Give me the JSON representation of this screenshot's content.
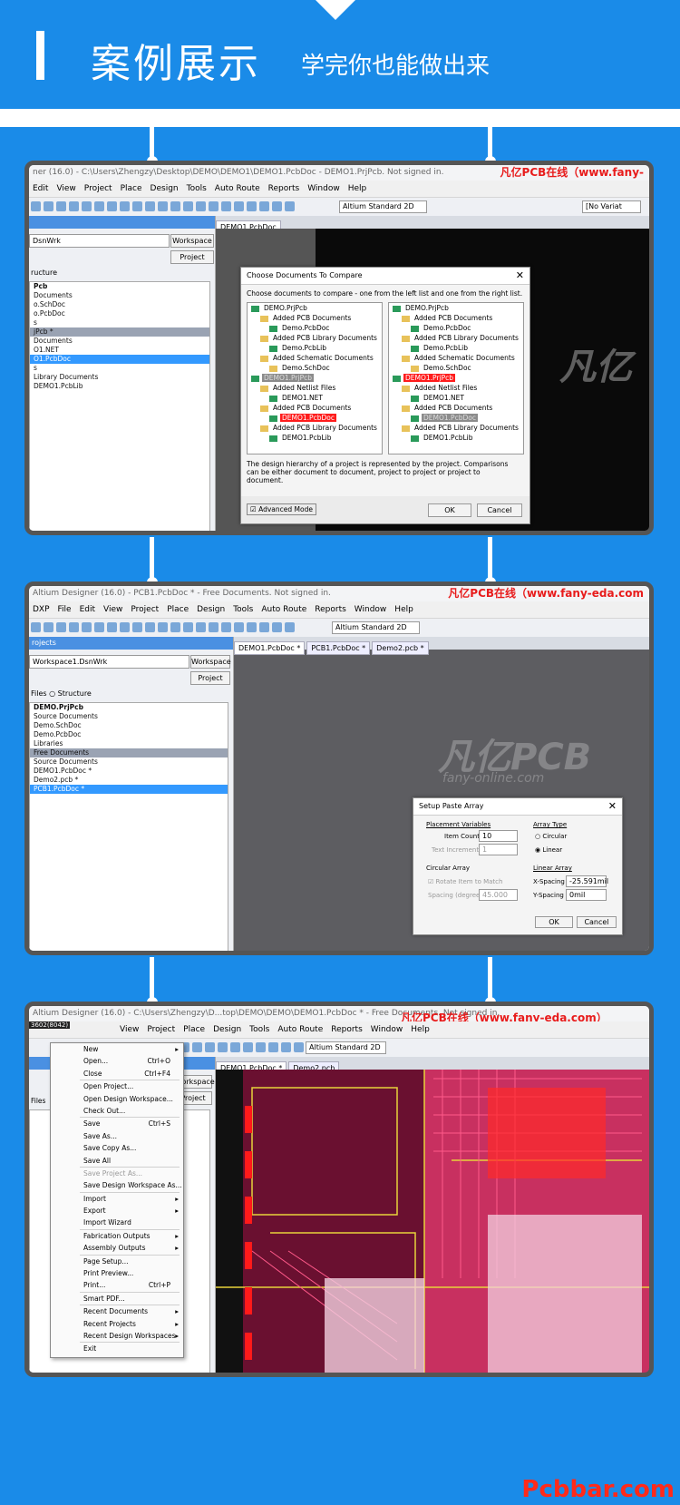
{
  "header": {
    "title": "案例展示",
    "subtitle": "学完你也能做出来"
  },
  "brand": "凡亿PCB在线（www.fany-eda.com）",
  "footer": "Pcbbar.com",
  "panel1": {
    "title": "ner (16.0) - C:\\Users\\Zhengzy\\Desktop\\DEMO\\DEMO1\\DEMO1.PcbDoc - DEMO1.PrjPcb. Not signed in.",
    "brand": "凡亿PCB在线（www.fany-",
    "menu": [
      "Edit",
      "View",
      "Project",
      "Place",
      "Design",
      "Tools",
      "Auto Route",
      "Reports",
      "Window",
      "Help"
    ],
    "view_mode": "Altium Standard 2D",
    "variant": "[No Variat",
    "workspace_value": "DsnWrk",
    "workspace_btn": "Workspace",
    "project_btn": "Project",
    "structure_label": "ructure",
    "tree": [
      {
        "text": "Pcb",
        "cls": "bold"
      },
      {
        "text": "Documents",
        "cls": ""
      },
      {
        "text": "o.SchDoc",
        "cls": ""
      },
      {
        "text": "o.PcbDoc",
        "cls": ""
      },
      {
        "text": "s",
        "cls": ""
      },
      {
        "text": "jPcb *",
        "cls": "grey"
      },
      {
        "text": "Documents",
        "cls": ""
      },
      {
        "text": "O1.NET",
        "cls": ""
      },
      {
        "text": "O1.PcbDoc",
        "cls": "sel"
      },
      {
        "text": "s",
        "cls": ""
      },
      {
        "text": "Library Documents",
        "cls": ""
      },
      {
        "text": "DEMO1.PcbLib",
        "cls": ""
      }
    ],
    "doc_tab": "DEMO1.PcbDoc",
    "dialog": {
      "title": "Choose Documents To Compare",
      "instruction": "Choose documents to compare - one from the left list and one from the right list.",
      "left_tree": [
        {
          "text": "DEMO.PrjPcb",
          "indent": 0,
          "cls": "",
          "icon": "pcb"
        },
        {
          "text": "Added PCB Documents",
          "indent": 1,
          "cls": "",
          "icon": "folder"
        },
        {
          "text": "Demo.PcbDoc",
          "indent": 2,
          "cls": "",
          "icon": "pcb"
        },
        {
          "text": "Added PCB Library Documents",
          "indent": 1,
          "cls": "",
          "icon": "folder"
        },
        {
          "text": "Demo.PcbLib",
          "indent": 2,
          "cls": "",
          "icon": "pcb"
        },
        {
          "text": "Added Schematic Documents",
          "indent": 1,
          "cls": "",
          "icon": "folder"
        },
        {
          "text": "Demo.SchDoc",
          "indent": 2,
          "cls": "",
          "icon": "folder"
        },
        {
          "text": "DEMO1.PrjPcb",
          "indent": 0,
          "cls": "graysel",
          "icon": "pcb"
        },
        {
          "text": "Added Netlist Files",
          "indent": 1,
          "cls": "",
          "icon": "folder"
        },
        {
          "text": "DEMO1.NET",
          "indent": 2,
          "cls": "",
          "icon": "pcb"
        },
        {
          "text": "Added PCB Documents",
          "indent": 1,
          "cls": "",
          "icon": "folder"
        },
        {
          "text": "DEMO1.PcbDoc",
          "indent": 2,
          "cls": "redsel",
          "icon": "pcb"
        },
        {
          "text": "Added PCB Library Documents",
          "indent": 1,
          "cls": "",
          "icon": "folder"
        },
        {
          "text": "DEMO1.PcbLib",
          "indent": 2,
          "cls": "",
          "icon": "pcb"
        }
      ],
      "right_tree": [
        {
          "text": "DEMO.PrjPcb",
          "indent": 0,
          "cls": "",
          "icon": "pcb"
        },
        {
          "text": "Added PCB Documents",
          "indent": 1,
          "cls": "",
          "icon": "folder"
        },
        {
          "text": "Demo.PcbDoc",
          "indent": 2,
          "cls": "",
          "icon": "pcb"
        },
        {
          "text": "Added PCB Library Documents",
          "indent": 1,
          "cls": "",
          "icon": "folder"
        },
        {
          "text": "Demo.PcbLib",
          "indent": 2,
          "cls": "",
          "icon": "pcb"
        },
        {
          "text": "Added Schematic Documents",
          "indent": 1,
          "cls": "",
          "icon": "folder"
        },
        {
          "text": "Demo.SchDoc",
          "indent": 2,
          "cls": "",
          "icon": "folder"
        },
        {
          "text": "DEMO1.PrjPcb",
          "indent": 0,
          "cls": "redsel",
          "icon": "pcb"
        },
        {
          "text": "Added Netlist Files",
          "indent": 1,
          "cls": "",
          "icon": "folder"
        },
        {
          "text": "DEMO1.NET",
          "indent": 2,
          "cls": "",
          "icon": "pcb"
        },
        {
          "text": "Added PCB Documents",
          "indent": 1,
          "cls": "",
          "icon": "folder"
        },
        {
          "text": "DEMO1.PcbDoc",
          "indent": 2,
          "cls": "graysel",
          "icon": "pcb"
        },
        {
          "text": "Added PCB Library Documents",
          "indent": 1,
          "cls": "",
          "icon": "folder"
        },
        {
          "text": "DEMO1.PcbLib",
          "indent": 2,
          "cls": "",
          "icon": "pcb"
        }
      ],
      "note": "The design hierarchy of a project is represented by the project. Comparisons can be either document to document, project to project or project to document.",
      "advanced": "Advanced Mode",
      "ok": "OK",
      "cancel": "Cancel"
    }
  },
  "panel2": {
    "title": "Altium Designer (16.0) - PCB1.PcbDoc * - Free Documents. Not signed in.",
    "brand": "凡亿PCB在线（www.fany-eda.com",
    "menu": [
      "DXP",
      "File",
      "Edit",
      "View",
      "Project",
      "Place",
      "Design",
      "Tools",
      "Auto Route",
      "Reports",
      "Window",
      "Help"
    ],
    "view_mode": "Altium Standard 2D",
    "panel_header": "rojects",
    "workspace_value": "Workspace1.DsnWrk",
    "workspace_btn": "Workspace",
    "project_btn": "Project",
    "files_label": "Files",
    "structure_label": "Structure",
    "tree": [
      {
        "text": "DEMO.PrjPcb",
        "cls": "bold"
      },
      {
        "text": "Source Documents",
        "cls": ""
      },
      {
        "text": "Demo.SchDoc",
        "cls": ""
      },
      {
        "text": "Demo.PcbDoc",
        "cls": ""
      },
      {
        "text": "Libraries",
        "cls": ""
      },
      {
        "text": "Free Documents",
        "cls": "grey"
      },
      {
        "text": "Source Documents",
        "cls": ""
      },
      {
        "text": "DEMO1.PcbDoc *",
        "cls": ""
      },
      {
        "text": "Demo2.pcb *",
        "cls": ""
      },
      {
        "text": "PCB1.PcbDoc *",
        "cls": "sel"
      }
    ],
    "tabs": [
      "DEMO1.PcbDoc *",
      "PCB1.PcbDoc *",
      "Demo2.pcb *"
    ],
    "watermark": "凡亿PCB",
    "watermark_sub": "fany-online.com",
    "dialog": {
      "title": "Setup Paste Array",
      "placement_label": "Placement Variables",
      "item_count_label": "Item Count",
      "item_count": "10",
      "text_increment_label": "Text Increment",
      "text_increment": "1",
      "array_type_label": "Array Type",
      "circular": "Circular",
      "linear": "Linear",
      "circular_array_label": "Circular Array",
      "rotate_label": "Rotate Item to Match",
      "spacing_label": "Spacing (degrees)",
      "spacing": "45.000",
      "linear_array_label": "Linear Array",
      "x_spacing_label": "X-Spacing",
      "x_spacing": "-25.591mil",
      "y_spacing_label": "Y-Spacing",
      "y_spacing": "0mil",
      "ok": "OK",
      "cancel": "Cancel"
    }
  },
  "panel3": {
    "title": "Altium Designer (16.0) - C:\\Users\\Zhengzy\\D...top\\DEMO\\DEMO\\DEMO1.PcbDoc * - Free Documents. Not signed in.",
    "brand": "凡亿PCB在线（www.fany-eda.com）",
    "coord": "3602(8042)",
    "menu": [
      "View",
      "Project",
      "Place",
      "Design",
      "Tools",
      "Auto Route",
      "Reports",
      "Window",
      "Help"
    ],
    "view_mode": "Altium Standard 2D",
    "workspace_btn": "Workspace",
    "project_btn": "Project",
    "files_label": "Files",
    "tabs": [
      "DEMO1.PcbDoc *",
      "Demo2.pcb"
    ],
    "context_menu": [
      {
        "label": "New",
        "shortcut": "",
        "arrow": "▸",
        "dis": false,
        "sep": false
      },
      {
        "label": "Open...",
        "shortcut": "Ctrl+O",
        "arrow": "",
        "dis": false,
        "sep": false
      },
      {
        "label": "Close",
        "shortcut": "Ctrl+F4",
        "arrow": "",
        "dis": false,
        "sep": true
      },
      {
        "label": "Open Project...",
        "shortcut": "",
        "arrow": "",
        "dis": false,
        "sep": false
      },
      {
        "label": "Open Design Workspace...",
        "shortcut": "",
        "arrow": "",
        "dis": false,
        "sep": false
      },
      {
        "label": "Check Out...",
        "shortcut": "",
        "arrow": "",
        "dis": false,
        "sep": true
      },
      {
        "label": "Save",
        "shortcut": "Ctrl+S",
        "arrow": "",
        "dis": false,
        "sep": false
      },
      {
        "label": "Save As...",
        "shortcut": "",
        "arrow": "",
        "dis": false,
        "sep": false
      },
      {
        "label": "Save Copy As...",
        "shortcut": "",
        "arrow": "",
        "dis": false,
        "sep": false
      },
      {
        "label": "Save All",
        "shortcut": "",
        "arrow": "",
        "dis": false,
        "sep": true
      },
      {
        "label": "Save Project As...",
        "shortcut": "",
        "arrow": "",
        "dis": true,
        "sep": false
      },
      {
        "label": "Save Design Workspace As...",
        "shortcut": "",
        "arrow": "",
        "dis": false,
        "sep": true
      },
      {
        "label": "Import",
        "shortcut": "",
        "arrow": "▸",
        "dis": false,
        "sep": false
      },
      {
        "label": "Export",
        "shortcut": "",
        "arrow": "▸",
        "dis": false,
        "sep": false
      },
      {
        "label": "Import Wizard",
        "shortcut": "",
        "arrow": "",
        "dis": false,
        "sep": true
      },
      {
        "label": "Fabrication Outputs",
        "shortcut": "",
        "arrow": "▸",
        "dis": false,
        "sep": false
      },
      {
        "label": "Assembly Outputs",
        "shortcut": "",
        "arrow": "▸",
        "dis": false,
        "sep": true
      },
      {
        "label": "Page Setup...",
        "shortcut": "",
        "arrow": "",
        "dis": false,
        "sep": false
      },
      {
        "label": "Print Preview...",
        "shortcut": "",
        "arrow": "",
        "dis": false,
        "sep": false
      },
      {
        "label": "Print...",
        "shortcut": "Ctrl+P",
        "arrow": "",
        "dis": false,
        "sep": true
      },
      {
        "label": "Smart PDF...",
        "shortcut": "",
        "arrow": "",
        "dis": false,
        "sep": true
      },
      {
        "label": "Recent Documents",
        "shortcut": "",
        "arrow": "▸",
        "dis": false,
        "sep": false
      },
      {
        "label": "Recent Projects",
        "shortcut": "",
        "arrow": "▸",
        "dis": false,
        "sep": false
      },
      {
        "label": "Recent Design Workspaces",
        "shortcut": "",
        "arrow": "▸",
        "dis": false,
        "sep": true
      },
      {
        "label": "Exit",
        "shortcut": "",
        "arrow": "",
        "dis": false,
        "sep": false
      }
    ]
  }
}
